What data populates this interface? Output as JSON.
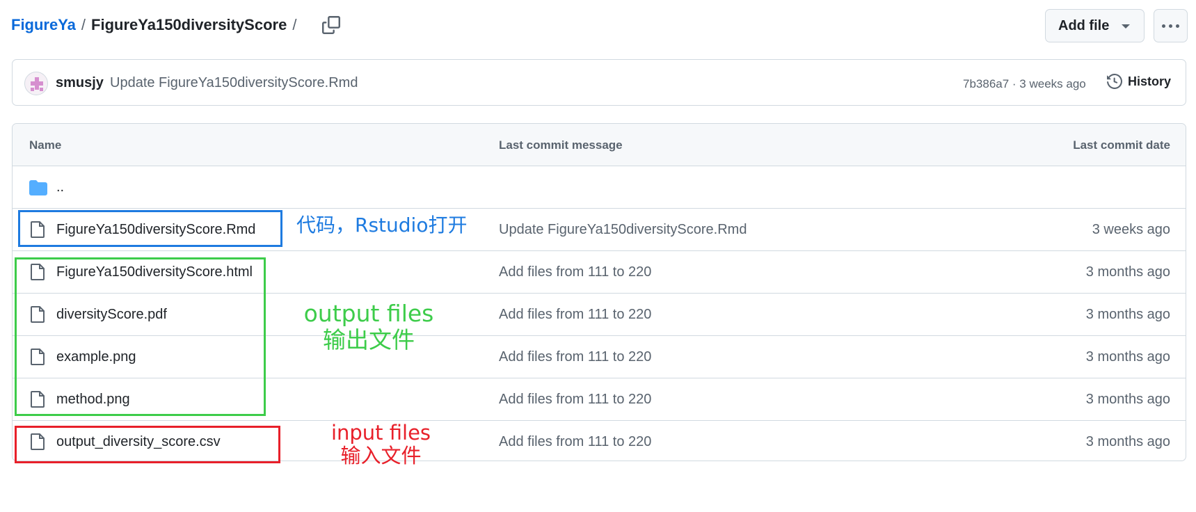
{
  "breadcrumb": {
    "repo": "FigureYa",
    "separator": "/",
    "current": "FigureYa150diversityScore",
    "trailing": "/"
  },
  "header": {
    "add_file_label": "Add file"
  },
  "commit": {
    "author": "smusjy",
    "message": "Update FigureYa150diversityScore.Rmd",
    "meta": "7b386a7 · 3 weeks ago",
    "history_label": "History"
  },
  "table": {
    "headers": {
      "name": "Name",
      "message": "Last commit message",
      "date": "Last commit date"
    },
    "parent": "..",
    "rows": [
      {
        "name": "FigureYa150diversityScore.Rmd",
        "message": "Update FigureYa150diversityScore.Rmd",
        "date": "3 weeks ago"
      },
      {
        "name": "FigureYa150diversityScore.html",
        "message": "Add files from 111 to 220",
        "date": "3 months ago"
      },
      {
        "name": "diversityScore.pdf",
        "message": "Add files from 111 to 220",
        "date": "3 months ago"
      },
      {
        "name": "example.png",
        "message": "Add files from 111 to 220",
        "date": "3 months ago"
      },
      {
        "name": "method.png",
        "message": "Add files from 111 to 220",
        "date": "3 months ago"
      },
      {
        "name": "output_diversity_score.csv",
        "message": "Add files from 111 to 220",
        "date": "3 months ago"
      }
    ]
  },
  "annotations": {
    "code": {
      "text": "代码，Rstudio打开",
      "color": "#1e7be0"
    },
    "output": {
      "line1": "output files",
      "line2": "输出文件",
      "color": "#3dcc4a"
    },
    "input": {
      "line1": "input files",
      "line2": "输入文件",
      "color": "#e8202a"
    }
  },
  "colors": {
    "link": "#0969da",
    "muted": "#59636e",
    "border": "#d1d9e0",
    "folder": "#54aeff"
  }
}
